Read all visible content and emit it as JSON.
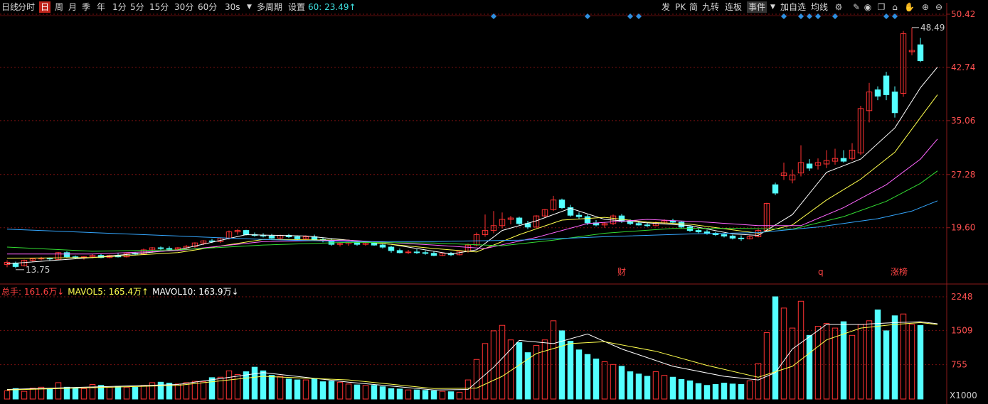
{
  "toolbar": {
    "periods": [
      {
        "label": "日线",
        "active": false
      },
      {
        "label": "分时",
        "active": false
      },
      {
        "label": "日",
        "active": true
      },
      {
        "label": "周",
        "active": false
      },
      {
        "label": "月",
        "active": false
      },
      {
        "label": "季",
        "active": false
      },
      {
        "label": "年",
        "active": false
      },
      {
        "label": "1分",
        "active": false
      },
      {
        "label": "5分",
        "active": false
      },
      {
        "label": "15分",
        "active": false
      },
      {
        "label": "30分",
        "active": false
      },
      {
        "label": "60分",
        "active": false
      }
    ],
    "dropdown_label": "30s",
    "multi_period": "多周期",
    "settings": "设置",
    "ma60_label": "60: 23.49↑",
    "right_buttons": [
      "发",
      "PK",
      "简",
      "九转",
      "连板",
      "事件",
      "加自选",
      "均线"
    ],
    "right_icons": [
      "gear-icon",
      "pencil-icon",
      "eye-icon",
      "copy-icon",
      "lock-icon",
      "hand-icon",
      "zoom-in-icon",
      "zoom-out-icon"
    ]
  },
  "colors": {
    "up": "#ff3232",
    "down": "#54ffff",
    "ma5": "#ffffff",
    "ma10": "#ffff4d",
    "ma20": "#ff66ff",
    "ma30": "#33dd33",
    "ma60": "#34a7ff",
    "grid": "#7a1010",
    "axis_text": "#ff5050",
    "diamond": "#2f8fe0",
    "vol_ma5": "#ffffff",
    "vol_ma10": "#ffff4d"
  },
  "chart_data": {
    "type": "candlestick",
    "price_axis": {
      "ticks": [
        "50.42",
        "42.74",
        "35.06",
        "27.28",
        "19.60"
      ],
      "ylim": [
        12.5,
        50.42
      ]
    },
    "annotations": {
      "high_label": "48.49",
      "low_label": "13.75",
      "events": [
        "财",
        "q",
        "涨榜"
      ]
    },
    "series_ohlc": [
      [
        14.3,
        14.9,
        13.9,
        14.6
      ],
      [
        14.5,
        14.7,
        13.75,
        14.0
      ],
      [
        14.1,
        15.0,
        14.0,
        14.9
      ],
      [
        14.9,
        15.2,
        14.7,
        15.1
      ],
      [
        15.1,
        15.4,
        14.9,
        15.2
      ],
      [
        15.2,
        15.3,
        14.9,
        15.1
      ],
      [
        15.0,
        16.1,
        15.0,
        16.0
      ],
      [
        16.0,
        16.2,
        15.3,
        15.4
      ],
      [
        15.4,
        15.6,
        15.1,
        15.3
      ],
      [
        15.3,
        15.5,
        15.0,
        15.4
      ],
      [
        15.4,
        15.8,
        15.2,
        15.6
      ],
      [
        15.6,
        15.8,
        15.2,
        15.3
      ],
      [
        15.3,
        15.7,
        15.2,
        15.6
      ],
      [
        15.6,
        15.9,
        15.3,
        15.4
      ],
      [
        15.4,
        16.0,
        15.3,
        15.9
      ],
      [
        15.9,
        16.1,
        15.6,
        15.8
      ],
      [
        15.8,
        16.6,
        15.7,
        16.4
      ],
      [
        16.4,
        16.8,
        16.0,
        16.7
      ],
      [
        16.7,
        16.9,
        16.3,
        16.6
      ],
      [
        16.6,
        16.9,
        16.3,
        16.5
      ],
      [
        16.5,
        16.8,
        16.2,
        16.7
      ],
      [
        16.7,
        17.1,
        16.5,
        16.9
      ],
      [
        16.9,
        17.5,
        16.7,
        17.4
      ],
      [
        17.4,
        17.8,
        17.1,
        17.7
      ],
      [
        17.7,
        18.0,
        17.4,
        17.6
      ],
      [
        17.6,
        18.2,
        17.4,
        18.1
      ],
      [
        18.1,
        19.2,
        17.9,
        19.0
      ],
      [
        19.0,
        19.4,
        18.6,
        19.2
      ],
      [
        19.2,
        19.3,
        18.5,
        18.6
      ],
      [
        18.6,
        18.9,
        18.3,
        18.5
      ],
      [
        18.5,
        18.8,
        18.2,
        18.4
      ],
      [
        18.4,
        18.7,
        18.0,
        18.1
      ],
      [
        18.1,
        18.6,
        17.9,
        18.5
      ],
      [
        18.5,
        18.7,
        18.1,
        18.3
      ],
      [
        18.3,
        18.5,
        17.8,
        18.0
      ],
      [
        18.0,
        18.5,
        17.9,
        18.3
      ],
      [
        18.3,
        18.6,
        17.8,
        17.9
      ],
      [
        17.9,
        18.2,
        17.5,
        17.8
      ],
      [
        17.8,
        18.0,
        17.0,
        17.2
      ],
      [
        17.2,
        17.5,
        16.9,
        17.3
      ],
      [
        17.3,
        17.6,
        17.0,
        17.5
      ],
      [
        17.5,
        17.7,
        17.0,
        17.2
      ],
      [
        17.2,
        17.6,
        17.0,
        17.4
      ],
      [
        17.4,
        17.6,
        17.0,
        17.1
      ],
      [
        17.1,
        17.3,
        16.6,
        16.8
      ],
      [
        16.8,
        17.0,
        16.0,
        16.3
      ],
      [
        16.3,
        16.6,
        15.9,
        16.0
      ],
      [
        16.0,
        16.4,
        15.8,
        16.1
      ],
      [
        16.1,
        16.5,
        15.8,
        16.0
      ],
      [
        16.0,
        16.3,
        15.7,
        15.9
      ],
      [
        15.9,
        16.2,
        15.5,
        15.6
      ],
      [
        15.6,
        16.0,
        15.5,
        15.9
      ],
      [
        15.9,
        16.1,
        15.5,
        15.7
      ],
      [
        15.7,
        16.3,
        15.6,
        16.2
      ],
      [
        16.2,
        17.3,
        16.0,
        17.1
      ],
      [
        17.1,
        18.9,
        16.9,
        18.6
      ],
      [
        18.6,
        21.5,
        18.3,
        19.2
      ],
      [
        19.2,
        22.0,
        18.8,
        19.9
      ],
      [
        19.9,
        21.8,
        19.5,
        20.8
      ],
      [
        20.8,
        21.3,
        20.1,
        21.0
      ],
      [
        21.0,
        21.2,
        20.0,
        20.2
      ],
      [
        20.2,
        20.6,
        19.4,
        19.7
      ],
      [
        19.7,
        21.4,
        19.5,
        21.3
      ],
      [
        21.3,
        22.3,
        21.1,
        22.2
      ],
      [
        22.2,
        24.2,
        22.0,
        23.6
      ],
      [
        23.6,
        23.8,
        22.3,
        22.5
      ],
      [
        22.5,
        22.9,
        21.2,
        21.4
      ],
      [
        21.4,
        21.8,
        20.8,
        21.2
      ],
      [
        21.2,
        21.5,
        20.0,
        20.3
      ],
      [
        20.3,
        20.7,
        19.8,
        20.0
      ],
      [
        20.0,
        20.4,
        19.6,
        20.2
      ],
      [
        20.2,
        21.5,
        20.0,
        21.3
      ],
      [
        21.3,
        21.6,
        20.3,
        20.5
      ],
      [
        20.5,
        20.8,
        20.0,
        20.2
      ],
      [
        20.2,
        20.6,
        19.9,
        20.0
      ],
      [
        20.0,
        20.4,
        19.7,
        19.9
      ],
      [
        19.9,
        20.5,
        19.8,
        20.3
      ],
      [
        20.3,
        20.8,
        20.1,
        20.6
      ],
      [
        20.6,
        20.9,
        20.2,
        20.4
      ],
      [
        20.4,
        20.6,
        19.5,
        19.7
      ],
      [
        19.7,
        19.9,
        19.0,
        19.2
      ],
      [
        19.2,
        19.5,
        18.8,
        19.0
      ],
      [
        19.0,
        19.3,
        18.6,
        18.8
      ],
      [
        18.8,
        19.0,
        18.4,
        18.6
      ],
      [
        18.6,
        18.8,
        18.2,
        18.4
      ],
      [
        18.4,
        18.6,
        17.9,
        18.1
      ],
      [
        18.1,
        18.5,
        17.7,
        18.0
      ],
      [
        18.0,
        18.5,
        17.9,
        18.3
      ],
      [
        18.3,
        19.4,
        18.2,
        19.2
      ],
      [
        19.2,
        23.2,
        19.1,
        23.1
      ],
      [
        25.8,
        26.1,
        24.3,
        24.6
      ],
      [
        27.1,
        29.0,
        26.5,
        27.5
      ],
      [
        26.5,
        28.0,
        26.0,
        27.2
      ],
      [
        27.5,
        31.5,
        27.0,
        29.0
      ],
      [
        28.8,
        29.5,
        27.8,
        28.2
      ],
      [
        28.6,
        29.6,
        28.0,
        29.0
      ],
      [
        28.8,
        30.8,
        28.2,
        29.3
      ],
      [
        29.2,
        31.0,
        28.7,
        29.6
      ],
      [
        29.6,
        30.8,
        29.0,
        29.2
      ],
      [
        29.6,
        31.8,
        29.3,
        30.8
      ],
      [
        30.4,
        37.2,
        30.1,
        36.8
      ],
      [
        36.5,
        40.5,
        34.8,
        39.2
      ],
      [
        39.5,
        40.0,
        38.0,
        38.6
      ],
      [
        41.5,
        42.1,
        38.0,
        38.8
      ],
      [
        39.2,
        40.0,
        35.5,
        36.2
      ],
      [
        39.0,
        48.0,
        38.5,
        47.6
      ],
      [
        45.0,
        48.49,
        44.5,
        45.2
      ],
      [
        46.0,
        47.0,
        43.5,
        43.7
      ]
    ],
    "ma_lines": {
      "ma5": [
        [
          0,
          14.4
        ],
        [
          10,
          15.3
        ],
        [
          20,
          16.4
        ],
        [
          28,
          18.6
        ],
        [
          35,
          18.4
        ],
        [
          45,
          17.2
        ],
        [
          52,
          15.8
        ],
        [
          55,
          16.4
        ],
        [
          58,
          19.2
        ],
        [
          62,
          20.6
        ],
        [
          66,
          22.4
        ],
        [
          70,
          20.8
        ],
        [
          75,
          20.3
        ],
        [
          80,
          19.9
        ],
        [
          85,
          18.7
        ],
        [
          88,
          18.5
        ],
        [
          92,
          21.5
        ],
        [
          96,
          27.6
        ],
        [
          100,
          29.5
        ],
        [
          104,
          34.0
        ],
        [
          107,
          39.8
        ],
        [
          109,
          42.8
        ]
      ],
      "ma10": [
        [
          0,
          15.2
        ],
        [
          10,
          15.3
        ],
        [
          20,
          16.0
        ],
        [
          30,
          17.9
        ],
        [
          40,
          17.8
        ],
        [
          50,
          16.6
        ],
        [
          55,
          16.1
        ],
        [
          60,
          18.6
        ],
        [
          65,
          20.7
        ],
        [
          70,
          21.1
        ],
        [
          75,
          20.4
        ],
        [
          80,
          20.1
        ],
        [
          88,
          18.8
        ],
        [
          92,
          20.0
        ],
        [
          96,
          23.6
        ],
        [
          100,
          26.6
        ],
        [
          104,
          30.5
        ],
        [
          107,
          35.5
        ],
        [
          109,
          38.8
        ]
      ],
      "ma20": [
        [
          0,
          15.8
        ],
        [
          10,
          15.8
        ],
        [
          20,
          16.3
        ],
        [
          30,
          17.6
        ],
        [
          40,
          17.8
        ],
        [
          50,
          17.1
        ],
        [
          56,
          16.6
        ],
        [
          62,
          18.2
        ],
        [
          68,
          20.2
        ],
        [
          75,
          20.8
        ],
        [
          82,
          20.4
        ],
        [
          88,
          19.9
        ],
        [
          93,
          19.9
        ],
        [
          98,
          22.5
        ],
        [
          103,
          25.8
        ],
        [
          107,
          29.5
        ],
        [
          109,
          32.4
        ]
      ],
      "ma30": [
        [
          0,
          16.8
        ],
        [
          10,
          16.2
        ],
        [
          20,
          16.4
        ],
        [
          30,
          17.1
        ],
        [
          40,
          17.5
        ],
        [
          50,
          17.4
        ],
        [
          58,
          17.0
        ],
        [
          64,
          17.8
        ],
        [
          70,
          18.8
        ],
        [
          78,
          19.5
        ],
        [
          86,
          19.5
        ],
        [
          92,
          19.4
        ],
        [
          98,
          21.2
        ],
        [
          103,
          23.4
        ],
        [
          107,
          26.0
        ],
        [
          109,
          27.8
        ]
      ],
      "ma60": [
        [
          0,
          19.4
        ],
        [
          10,
          18.9
        ],
        [
          20,
          18.4
        ],
        [
          30,
          17.9
        ],
        [
          40,
          17.6
        ],
        [
          50,
          17.6
        ],
        [
          60,
          17.8
        ],
        [
          70,
          18.3
        ],
        [
          80,
          18.7
        ],
        [
          88,
          18.9
        ],
        [
          95,
          19.7
        ],
        [
          102,
          20.9
        ],
        [
          106,
          22.0
        ],
        [
          109,
          23.49
        ]
      ]
    },
    "volume_axis": {
      "ticks": [
        "2248",
        "1509",
        "755"
      ],
      "unit": "X1000",
      "ylim": [
        0,
        2248
      ]
    },
    "volume": [
      180,
      230,
      170,
      240,
      260,
      230,
      360,
      260,
      240,
      230,
      320,
      300,
      260,
      280,
      260,
      260,
      300,
      360,
      370,
      350,
      330,
      360,
      390,
      380,
      470,
      480,
      620,
      540,
      600,
      700,
      620,
      520,
      500,
      440,
      420,
      420,
      450,
      380,
      390,
      370,
      330,
      310,
      300,
      300,
      270,
      230,
      220,
      200,
      200,
      190,
      180,
      170,
      160,
      150,
      420,
      870,
      1220,
      1500,
      1620,
      1300,
      1240,
      1020,
      1180,
      1300,
      1720,
      1500,
      1270,
      1080,
      980,
      880,
      820,
      760,
      720,
      600,
      550,
      500,
      600,
      520,
      480,
      430,
      400,
      340,
      300,
      320,
      350,
      330,
      320,
      400,
      780,
      1460,
      2248,
      2000,
      1560,
      2150,
      1400,
      1600,
      1660,
      1560,
      1700,
      1400,
      1640,
      1720,
      1960,
      1500,
      1830,
      1870,
      1640,
      1616
    ],
    "volume_mas": {
      "ma5": [
        [
          0,
          210
        ],
        [
          20,
          320
        ],
        [
          30,
          580
        ],
        [
          40,
          370
        ],
        [
          50,
          200
        ],
        [
          54,
          210
        ],
        [
          57,
          700
        ],
        [
          60,
          1290
        ],
        [
          64,
          1220
        ],
        [
          68,
          1430
        ],
        [
          72,
          1100
        ],
        [
          78,
          720
        ],
        [
          84,
          500
        ],
        [
          88,
          420
        ],
        [
          90,
          580
        ],
        [
          92,
          1100
        ],
        [
          96,
          1640
        ],
        [
          100,
          1640
        ],
        [
          104,
          1680
        ],
        [
          107,
          1700
        ],
        [
          109,
          1654
        ]
      ],
      "ma10": [
        [
          0,
          200
        ],
        [
          20,
          300
        ],
        [
          30,
          500
        ],
        [
          40,
          420
        ],
        [
          50,
          230
        ],
        [
          55,
          240
        ],
        [
          58,
          500
        ],
        [
          62,
          1000
        ],
        [
          66,
          1220
        ],
        [
          70,
          1260
        ],
        [
          76,
          1050
        ],
        [
          82,
          740
        ],
        [
          88,
          480
        ],
        [
          92,
          720
        ],
        [
          96,
          1300
        ],
        [
          100,
          1560
        ],
        [
          104,
          1640
        ],
        [
          107,
          1680
        ],
        [
          109,
          1639
        ]
      ]
    },
    "volume_legend": [
      {
        "label": "总手: ",
        "value": "161.6万↓"
      },
      {
        "label": "MAVOL5: ",
        "value": "165.4万↑"
      },
      {
        "label": "MAVOL10: ",
        "value": "163.9万↓"
      }
    ]
  }
}
